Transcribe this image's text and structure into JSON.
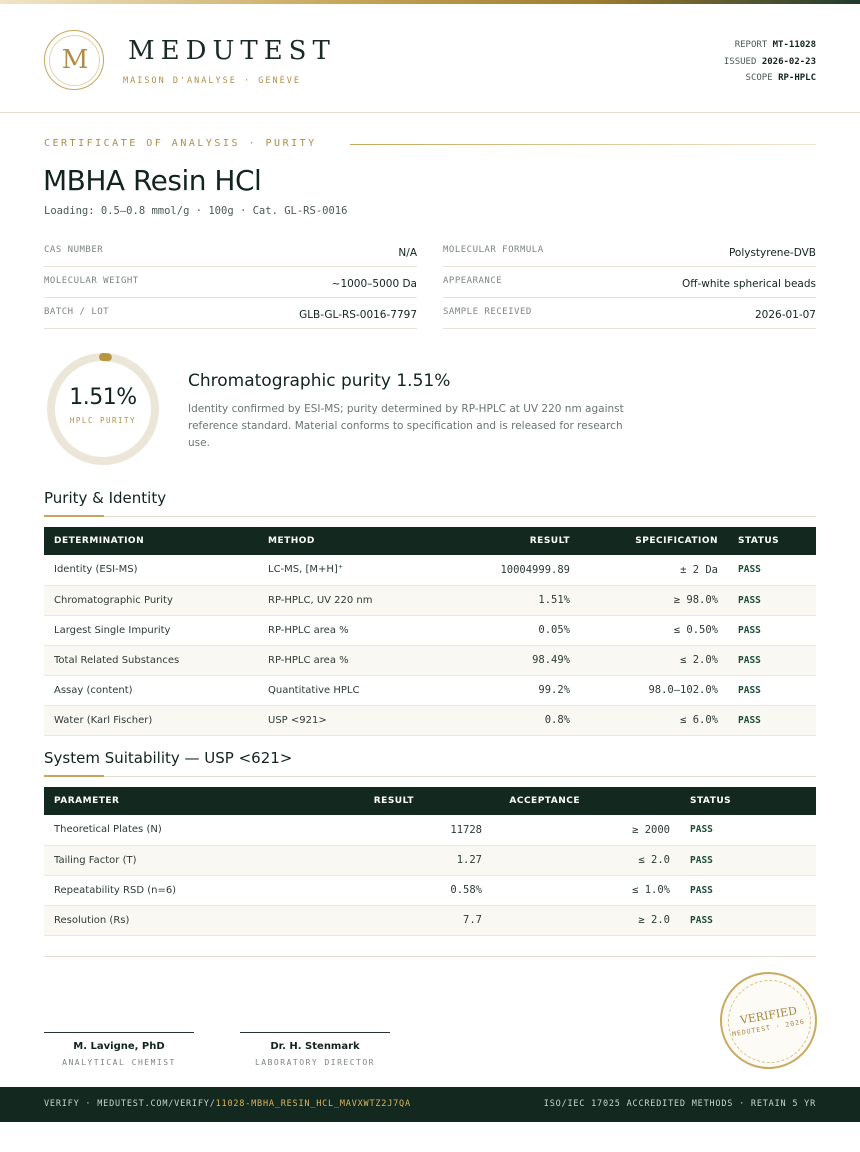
{
  "header": {
    "logo_letter": "M",
    "brand": "MEDUTEST",
    "tagline": "MAISON D'ANALYSE · GENÈVE",
    "report_label": "REPORT",
    "report_value": "MT-11028",
    "issued_label": "ISSUED",
    "issued_value": "2026-02-23",
    "scope_label": "SCOPE",
    "scope_value": "RP-HPLC"
  },
  "document": {
    "eyebrow": "CERTIFICATE OF ANALYSIS · PURITY",
    "title": "MBHA Resin HCl",
    "subtitle": "Loading: 0.5–0.8 mmol/g · 100g  ·  Cat. GL-RS-0016"
  },
  "properties": [
    {
      "key": "CAS NUMBER",
      "value": "N/A"
    },
    {
      "key": "MOLECULAR FORMULA",
      "value": "Polystyrene-DVB"
    },
    {
      "key": "MOLECULAR WEIGHT",
      "value": "~1000–5000 Da"
    },
    {
      "key": "APPEARANCE",
      "value": "Off-white spherical beads"
    },
    {
      "key": "BATCH / LOT",
      "value": "GLB-GL-RS-0016-7797"
    },
    {
      "key": "SAMPLE RECEIVED",
      "value": "2026-01-07"
    }
  ],
  "purity": {
    "value_text": "1.51%",
    "fraction": 0.0151,
    "label": "HPLC PURITY",
    "title": "Chromatographic purity 1.51%",
    "description": "Identity confirmed by ESI-MS; purity determined by RP-HPLC at UV 220 nm against reference standard. Material conforms to specification and is released for research use."
  },
  "purity_section": {
    "title": "Purity & Identity",
    "headers": [
      "DETERMINATION",
      "METHOD",
      "RESULT",
      "SPECIFICATION",
      "STATUS"
    ],
    "rows": [
      [
        "Identity (ESI-MS)",
        "LC-MS, [M+H]⁺",
        "10004999.89",
        "± 2 Da",
        "PASS"
      ],
      [
        "Chromatographic Purity",
        "RP-HPLC, UV 220 nm",
        "1.51%",
        "≥ 98.0%",
        "PASS"
      ],
      [
        "Largest Single Impurity",
        "RP-HPLC area %",
        "0.05%",
        "≤ 0.50%",
        "PASS"
      ],
      [
        "Total Related Substances",
        "RP-HPLC area %",
        "98.49%",
        "≤ 2.0%",
        "PASS"
      ],
      [
        "Assay (content)",
        "Quantitative HPLC",
        "99.2%",
        "98.0–102.0%",
        "PASS"
      ],
      [
        "Water (Karl Fischer)",
        "USP <921>",
        "0.8%",
        "≤ 6.0%",
        "PASS"
      ]
    ]
  },
  "suitability_section": {
    "title": "System Suitability — USP <621>",
    "headers": [
      "PARAMETER",
      "RESULT",
      "ACCEPTANCE",
      "STATUS"
    ],
    "rows": [
      [
        "Theoretical Plates (N)",
        "11728",
        "≥ 2000",
        "PASS"
      ],
      [
        "Tailing Factor (T)",
        "1.27",
        "≤ 2.0",
        "PASS"
      ],
      [
        "Repeatability RSD (n=6)",
        "0.58%",
        "≤ 1.0%",
        "PASS"
      ],
      [
        "Resolution (Rs)",
        "7.7",
        "≥ 2.0",
        "PASS"
      ]
    ]
  },
  "signatures": [
    {
      "name": "M. Lavigne, PhD",
      "role": "ANALYTICAL CHEMIST"
    },
    {
      "name": "Dr. H. Stenmark",
      "role": "LABORATORY DIRECTOR"
    }
  ],
  "seal": {
    "text": "VERIFIED",
    "sub": "MEDUTEST · 2026"
  },
  "footer": {
    "verify_prefix": "VERIFY · MEDUTEST.COM/VERIFY/",
    "verify_code": "11028-MBHA_RESIN_HCL_MAVXWTZ2J7QA",
    "right": "ISO/IEC 17025 ACCREDITED METHODS · RETAIN 5 YR"
  },
  "colors": {
    "accent_gold": "#c7a65b",
    "dark_green": "#13291f",
    "pass_green": "#1c4d34",
    "gauge_track": "#ece6d8"
  }
}
